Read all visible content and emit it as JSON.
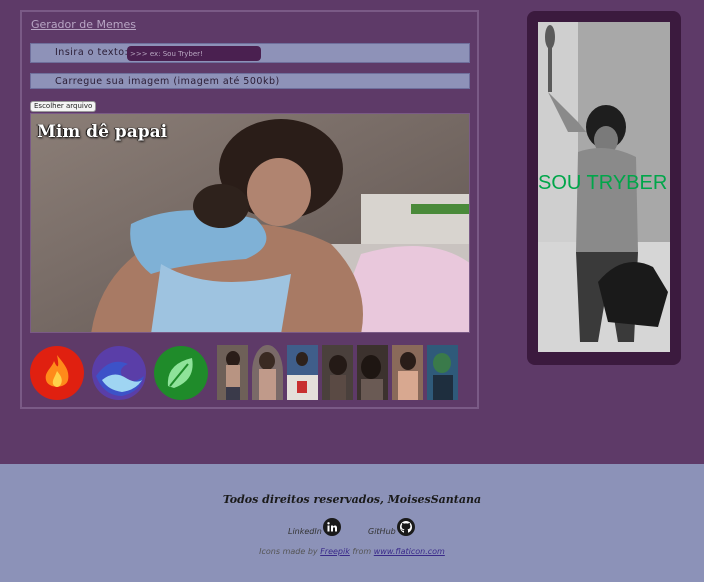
{
  "app": {
    "title": "Gerador de Memes"
  },
  "text_input": {
    "label": "Insira o texto:",
    "placeholder": ">>> ex: Sou Tryber!"
  },
  "upload": {
    "label": "Carregue sua imagem (imagem até 500kb)",
    "button_label": "Escolher arquivo"
  },
  "meme": {
    "caption": "Mim dê papai"
  },
  "presets": {
    "frames": [
      {
        "name": "fire-frame-icon",
        "colors": [
          "#e02010",
          "#ff8a1a"
        ]
      },
      {
        "name": "water-frame-icon",
        "colors": [
          "#3d52c8",
          "#9fd5f2"
        ]
      },
      {
        "name": "earth-frame-icon",
        "colors": [
          "#1f8b2a",
          "#8fe39a"
        ]
      }
    ],
    "thumbnails_count": 7
  },
  "side_card": {
    "text": "SOU TRYBER",
    "text_color": "#00a64a"
  },
  "footer": {
    "copyright": "Todos direitos reservados, MoisesSantana",
    "linkedin_label": "LinkedIn",
    "github_label": "GitHub",
    "credits_prefix": "Icons made by",
    "credits_author": "Freepik",
    "credits_from": "from",
    "credits_site": "www.flaticon.com"
  }
}
